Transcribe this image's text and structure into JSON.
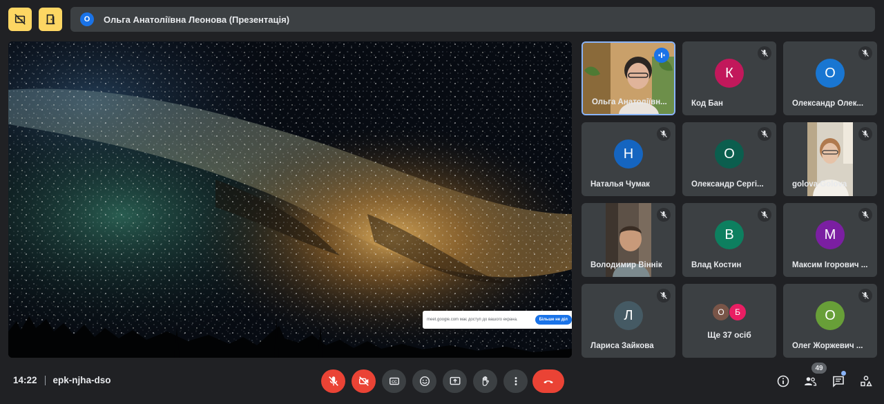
{
  "top_bar": {
    "presenter_initial": "О",
    "presenter_label": "Ольга Анатоліївна Леонова (Презентація)"
  },
  "stage": {
    "notice_text": "meet.google.com має доступ до вашого екрана.",
    "notice_button": "Більше не діл"
  },
  "participants": [
    {
      "name": "Ольга Анатоліївн...",
      "type": "video",
      "speaking": true
    },
    {
      "name": "Код Бан",
      "initial": "К",
      "color": "#c2185b",
      "muted": true
    },
    {
      "name": "Олександр Олек...",
      "initial": "О",
      "color": "#1976d2",
      "muted": true
    },
    {
      "name": "Наталья Чумак",
      "initial": "Н",
      "color": "#1565c0",
      "muted": true
    },
    {
      "name": "Олександр Сергі...",
      "initial": "О",
      "color": "#0b5e4e",
      "muted": true
    },
    {
      "name": "golova  Golova",
      "type": "video",
      "muted": true
    },
    {
      "name": "Володимир Віннік",
      "type": "video",
      "muted": true
    },
    {
      "name": "Влад Костин",
      "initial": "В",
      "color": "#0d7f5f",
      "muted": true
    },
    {
      "name": "Максим Ігорович ...",
      "initial": "М",
      "color": "#7b1fa2",
      "muted": true
    },
    {
      "name": "Лариса Зайкова",
      "initial": "Л",
      "color": "#455a64",
      "muted": true
    },
    {
      "name": "Олег Жоржевич ...",
      "initial": "О",
      "color": "#689f38",
      "muted": true
    }
  ],
  "more_tile": {
    "avatars": [
      {
        "initial": "О",
        "color": "#795548"
      },
      {
        "initial": "Б",
        "color": "#e91e63"
      }
    ],
    "label": "Ще 37 осіб"
  },
  "bottom_bar": {
    "time": "14:22",
    "meeting_code": "epk-njha-dso",
    "people_count": "49"
  },
  "icons": {
    "top_left_1": "no-captions-icon",
    "top_left_2": "door-exit-icon",
    "mic": "mic-off-icon",
    "camera": "camera-off-icon",
    "captions": "captions-icon",
    "emoji": "emoji-icon",
    "present": "present-screen-icon",
    "hand": "raise-hand-icon",
    "more": "more-vert-icon",
    "leave": "phone-hangup-icon",
    "info": "info-icon",
    "people": "people-icon",
    "chat": "chat-icon",
    "activities": "activities-icon"
  },
  "colors": {
    "accent": "#fdd663",
    "danger": "#ea4335",
    "surface": "#3c4043",
    "background": "#202124",
    "active_border": "#8ab4f8"
  }
}
